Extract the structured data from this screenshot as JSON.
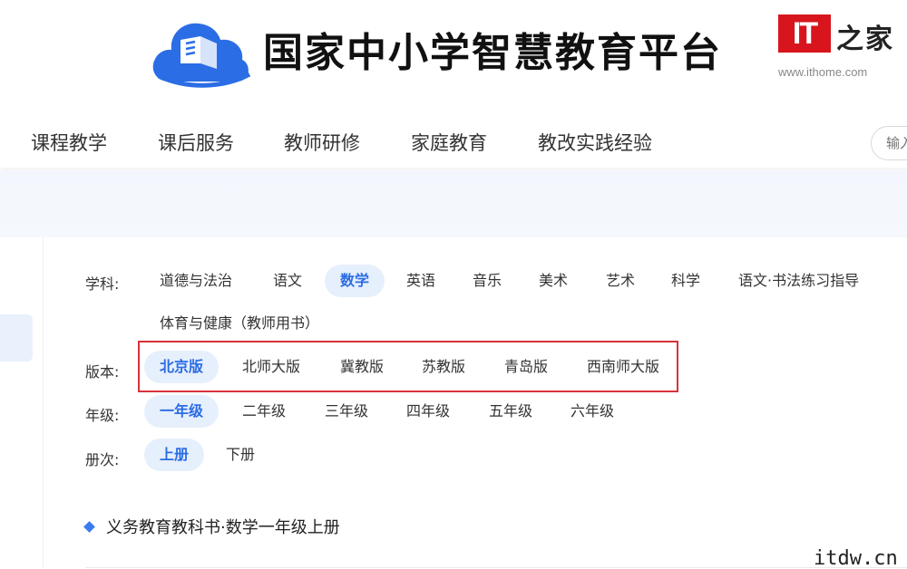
{
  "header": {
    "site_title": "国家中小学智慧教育平台",
    "logo_icon": "cloud-book-logo",
    "brand_color": "#2b6de5"
  },
  "ithome": {
    "badge": "IT",
    "cn_text": "之家",
    "url": "www.ithome.com",
    "badge_color": "#d8151d"
  },
  "nav": {
    "items": [
      "课程教学",
      "课后服务",
      "教师研修",
      "家庭教育",
      "教改实践经验"
    ],
    "search_placeholder": "输入"
  },
  "filters": {
    "subject": {
      "label": "学科:",
      "options": [
        "道德与法治",
        "语文",
        "数学",
        "英语",
        "音乐",
        "美术",
        "艺术",
        "科学",
        "语文·书法练习指导",
        "体育与健康（教师用书）"
      ],
      "selected": "数学"
    },
    "edition": {
      "label": "版本:",
      "options": [
        "北京版",
        "北师大版",
        "冀教版",
        "苏教版",
        "青岛版",
        "西南师大版"
      ],
      "selected": "北京版"
    },
    "grade": {
      "label": "年级:",
      "options": [
        "一年级",
        "二年级",
        "三年级",
        "四年级",
        "五年级",
        "六年级"
      ],
      "selected": "一年级"
    },
    "volume": {
      "label": "册次:",
      "options": [
        "上册",
        "下册"
      ],
      "selected": "上册"
    }
  },
  "book": {
    "title": "义务教育教科书·数学一年级上册"
  },
  "watermark": "itdw.cn"
}
